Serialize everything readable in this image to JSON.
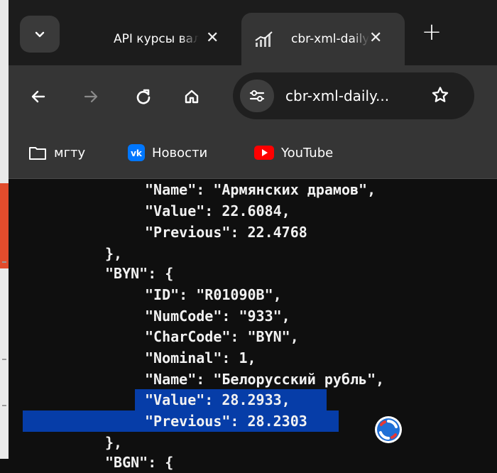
{
  "browser": {
    "tabs": [
      {
        "title": "API курсы валют ЦБ",
        "active": false,
        "close_icon": "close-icon"
      },
      {
        "title": "cbr-xml-daily.ru",
        "active": true,
        "close_icon": "close-icon"
      }
    ],
    "new_tab_label": "+",
    "address_bar": {
      "url": "cbr-xml-daily..."
    },
    "bookmarks": [
      {
        "label": "мгту",
        "icon": "folder-icon"
      },
      {
        "label": "Новости",
        "icon": "vk-icon"
      },
      {
        "label": "YouTube",
        "icon": "youtube-icon"
      }
    ]
  },
  "json_view": {
    "lines": [
      "\"Name\": \"Армянских драмов\",",
      "\"Value\": 22.6084,",
      "\"Previous\": 22.4768",
      "},",
      "\"BYN\": {",
      "\"ID\": \"R01090B\",",
      "\"NumCode\": \"933\",",
      "\"CharCode\": \"BYN\",",
      "\"Nominal\": 1,",
      "\"Name\": \"Белорусский рубль\",",
      "\"Value\": 28.2933,",
      "\"Previous\": 28.2303",
      "},",
      "\"BGN\": {"
    ],
    "selected_lines": [
      10,
      11
    ]
  },
  "colors": {
    "selection": "#063da8",
    "tab_active": "#353535",
    "toolbar": "#353535",
    "page_background": "#0f0f0f",
    "youtube_red": "#ff0000",
    "vk_blue": "#0077ff"
  }
}
